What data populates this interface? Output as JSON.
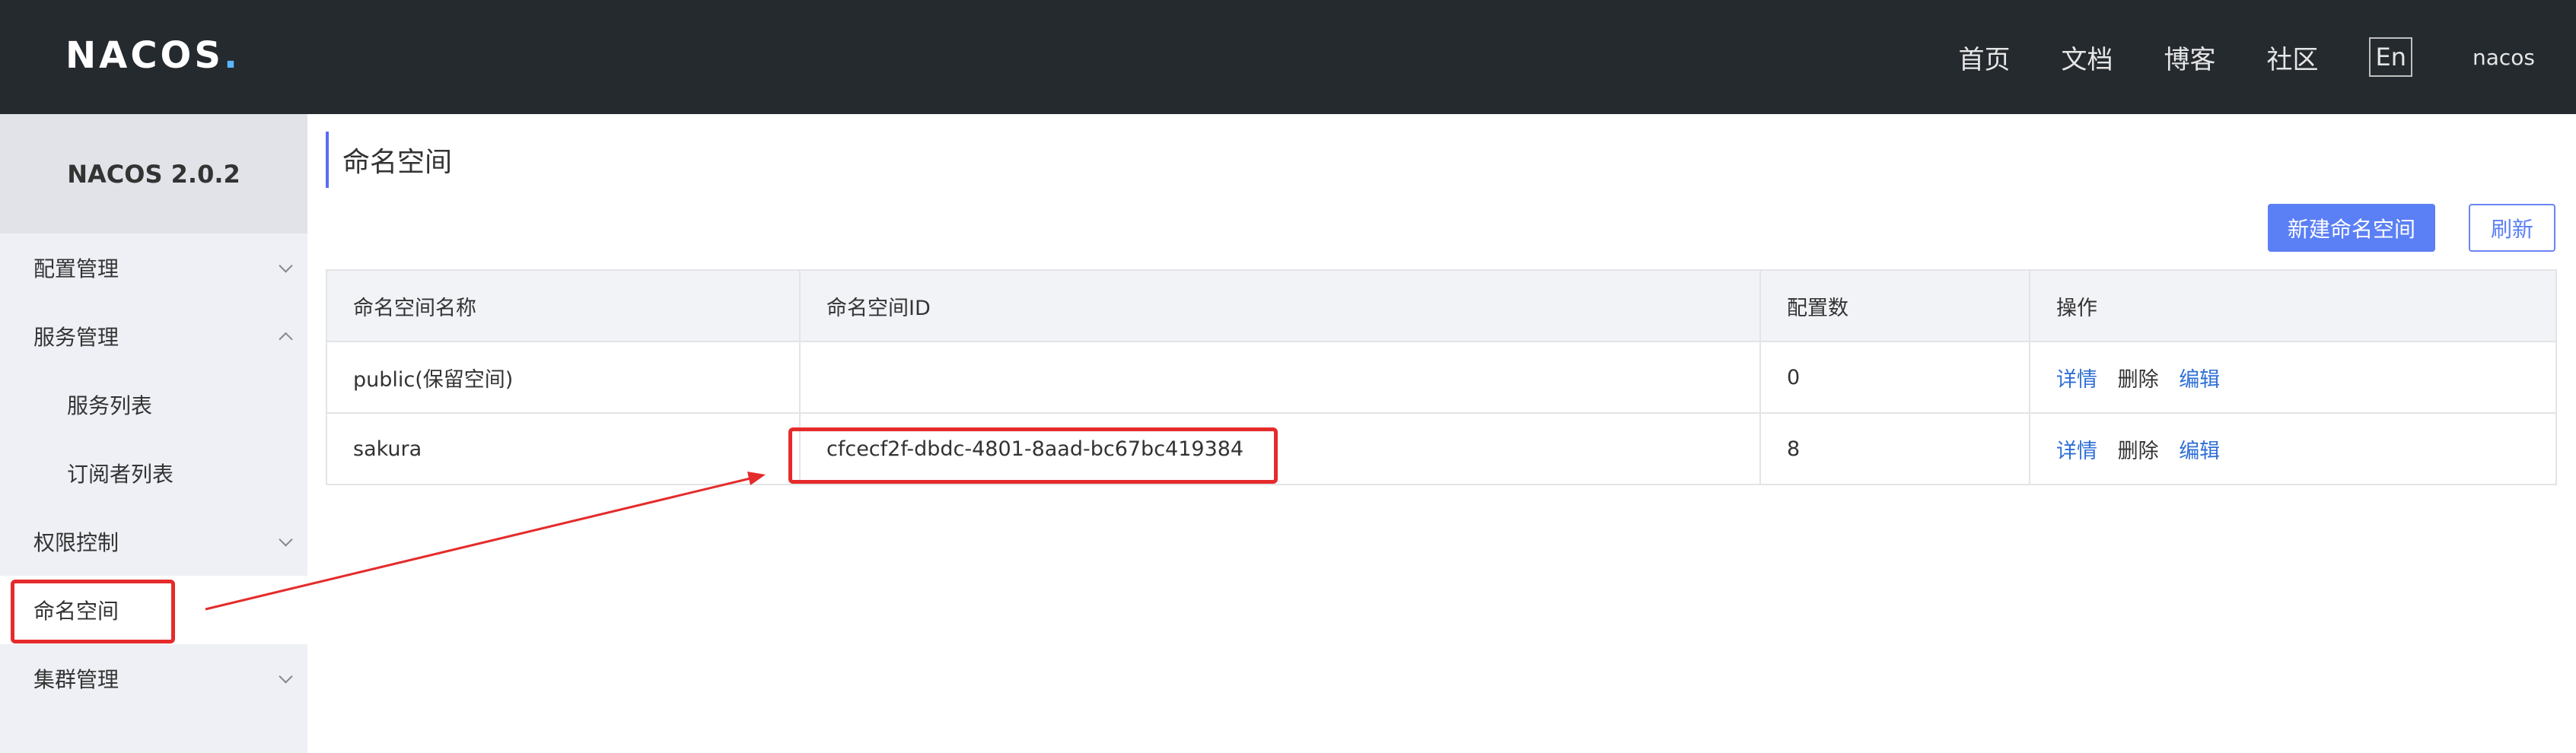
{
  "header": {
    "logo_text": "NACOS",
    "logo_dot": ".",
    "nav": [
      "首页",
      "文档",
      "博客",
      "社区"
    ],
    "lang_button": "En",
    "user": "nacos"
  },
  "sidebar": {
    "version": "NACOS 2.0.2",
    "menu": {
      "config": "配置管理",
      "service": "服务管理",
      "service_list": "服务列表",
      "subscriber_list": "订阅者列表",
      "permission": "权限控制",
      "namespace": "命名空间",
      "cluster": "集群管理"
    }
  },
  "main": {
    "title": "命名空间",
    "new_button": "新建命名空间",
    "refresh_button": "刷新",
    "columns": [
      "命名空间名称",
      "命名空间ID",
      "配置数",
      "操作"
    ],
    "rows": [
      {
        "name": "public(保留空间)",
        "id": "",
        "count": "0",
        "ops": [
          "详情",
          "删除",
          "编辑"
        ]
      },
      {
        "name": "sakura",
        "id": "cfcecf2f-dbdc-4801-8aad-bc67bc419384",
        "count": "8",
        "ops": [
          "详情",
          "删除",
          "编辑"
        ]
      }
    ]
  },
  "annotation": {
    "color": "#e52b2b"
  }
}
